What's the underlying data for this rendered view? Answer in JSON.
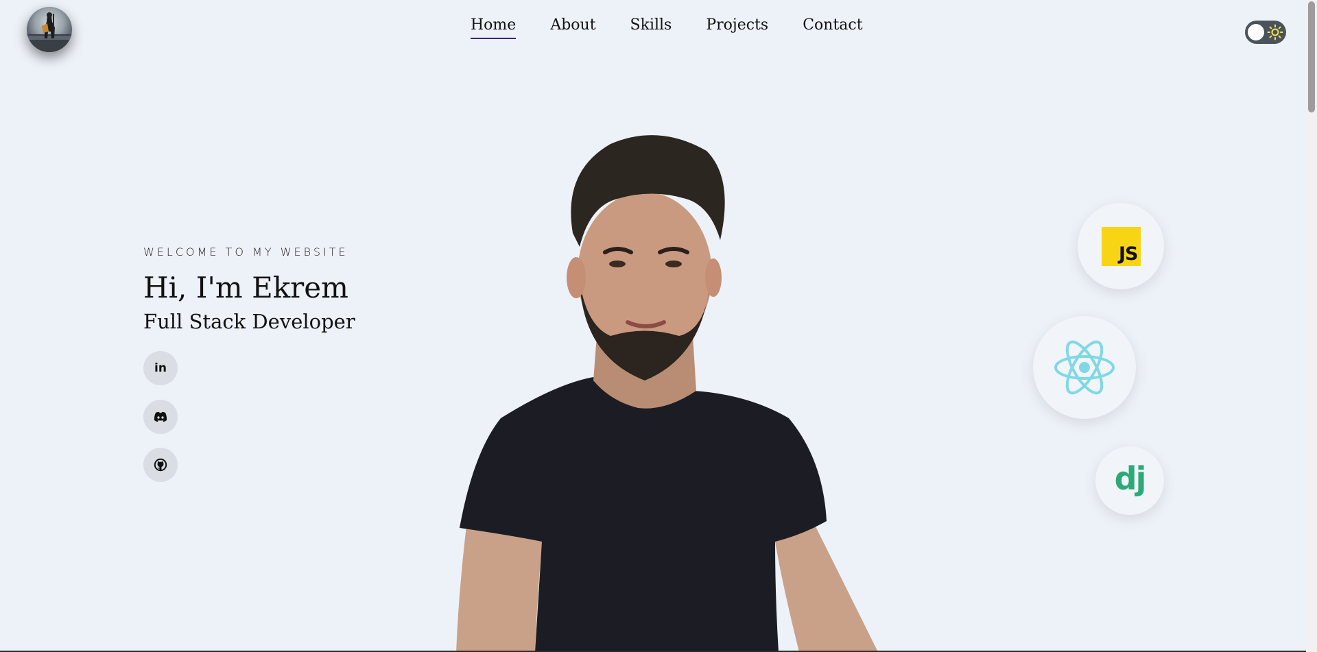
{
  "nav": {
    "items": [
      {
        "label": "Home",
        "active": true
      },
      {
        "label": "About",
        "active": false
      },
      {
        "label": "Skills",
        "active": false
      },
      {
        "label": "Projects",
        "active": false
      },
      {
        "label": "Contact",
        "active": false
      }
    ]
  },
  "header": {
    "logo_icon": "avatar-logo",
    "theme_toggle_icon": "sun-icon"
  },
  "hero": {
    "eyebrow": "WELCOME TO MY WEBSITE",
    "title": "Hi, I'm Ekrem",
    "subtitle": "Full Stack Developer",
    "socials": [
      {
        "icon": "linkedin-icon",
        "label": "in"
      },
      {
        "icon": "discord-icon"
      },
      {
        "icon": "github-icon"
      }
    ]
  },
  "tech": {
    "js_label": "JS",
    "django_label": "dj",
    "react_icon": "react-icon"
  },
  "colors": {
    "background": "#edf2f8",
    "nav_active_underline": "#3b1f7a",
    "js_yellow": "#f7d515",
    "react_cyan": "#7fd8e6",
    "django_green": "#2ba977"
  }
}
